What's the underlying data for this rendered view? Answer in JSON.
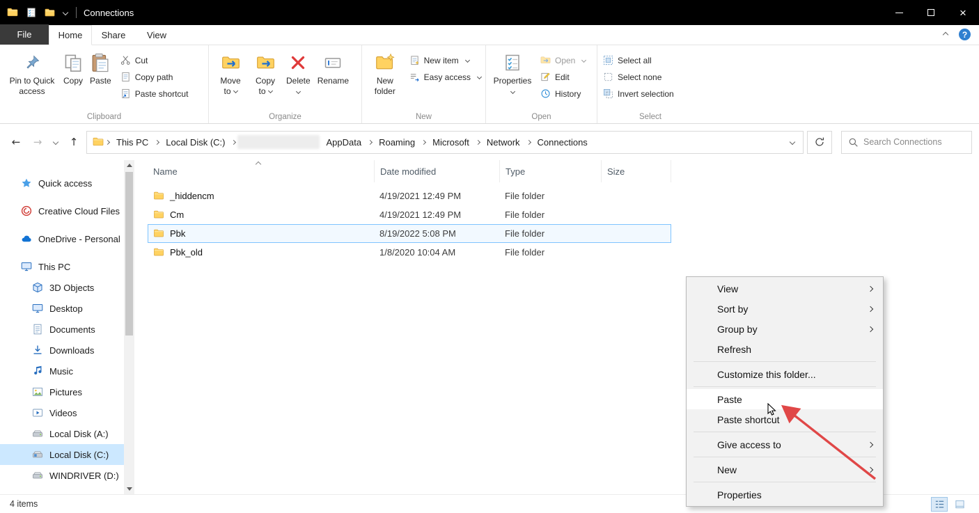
{
  "window": {
    "title": "Connections"
  },
  "icons": {
    "help": "?",
    "close": "×",
    "back": "←",
    "forward": "→",
    "up": "↑"
  },
  "tabs": {
    "file": "File",
    "home": "Home",
    "share": "Share",
    "view": "View"
  },
  "ribbon": {
    "clipboard": {
      "label": "Clipboard",
      "pin": "Pin to Quick access",
      "copy": "Copy",
      "paste": "Paste",
      "cut": "Cut",
      "copy_path": "Copy path",
      "paste_shortcut": "Paste shortcut"
    },
    "organize": {
      "label": "Organize",
      "move_to": "Move to",
      "copy_to": "Copy to",
      "delete": "Delete",
      "rename": "Rename"
    },
    "new_group": {
      "label": "New",
      "new_folder": "New folder",
      "new_item": "New item",
      "easy_access": "Easy access"
    },
    "open_group": {
      "label": "Open",
      "properties": "Properties",
      "open": "Open",
      "edit": "Edit",
      "history": "History"
    },
    "select_group": {
      "label": "Select",
      "select_all": "Select all",
      "select_none": "Select none",
      "invert": "Invert selection"
    }
  },
  "address": {
    "crumbs": [
      "This PC",
      "Local Disk (C:)",
      "",
      "AppData",
      "Roaming",
      "Microsoft",
      "Network",
      "Connections"
    ],
    "search_placeholder": "Search Connections"
  },
  "sidebar": {
    "items": [
      {
        "label": "Quick access",
        "icon": "star-icon"
      },
      {
        "label": "Creative Cloud Files",
        "icon": "creative-cloud-icon"
      },
      {
        "label": "OneDrive - Personal",
        "icon": "onedrive-cloud-icon"
      },
      {
        "label": "This PC",
        "icon": "monitor-icon"
      },
      {
        "label": "3D Objects",
        "icon": "cube-icon"
      },
      {
        "label": "Desktop",
        "icon": "monitor-icon"
      },
      {
        "label": "Documents",
        "icon": "document-icon"
      },
      {
        "label": "Downloads",
        "icon": "download-icon"
      },
      {
        "label": "Music",
        "icon": "music-note-icon"
      },
      {
        "label": "Pictures",
        "icon": "picture-icon"
      },
      {
        "label": "Videos",
        "icon": "video-icon"
      },
      {
        "label": "Local Disk (A:)",
        "icon": "drive-icon"
      },
      {
        "label": "Local Disk (C:)",
        "icon": "windows-drive-icon"
      },
      {
        "label": "WINDRIVER (D:)",
        "icon": "drive-icon"
      }
    ]
  },
  "files": {
    "columns": {
      "name": "Name",
      "date": "Date modified",
      "type": "Type",
      "size": "Size"
    },
    "rows": [
      {
        "name": "_hiddencm",
        "date": "4/19/2021 12:49 PM",
        "type": "File folder",
        "size": ""
      },
      {
        "name": "Cm",
        "date": "4/19/2021 12:49 PM",
        "type": "File folder",
        "size": ""
      },
      {
        "name": "Pbk",
        "date": "8/19/2022 5:08 PM",
        "type": "File folder",
        "size": ""
      },
      {
        "name": "Pbk_old",
        "date": "1/8/2020 10:04 AM",
        "type": "File folder",
        "size": ""
      }
    ]
  },
  "context_menu": {
    "view": "View",
    "sort_by": "Sort by",
    "group_by": "Group by",
    "refresh": "Refresh",
    "customize": "Customize this folder...",
    "paste": "Paste",
    "paste_shortcut": "Paste shortcut",
    "give_access": "Give access to",
    "new": "New",
    "properties": "Properties"
  },
  "status": {
    "count": "4 items"
  },
  "colors": {
    "accent": "#0078d7",
    "titlebar": "#000000",
    "selection": "#cce8ff",
    "folder_yellow": "#ffd261",
    "arrow_red": "#e04747",
    "menu_bg": "#f2f2f2"
  }
}
